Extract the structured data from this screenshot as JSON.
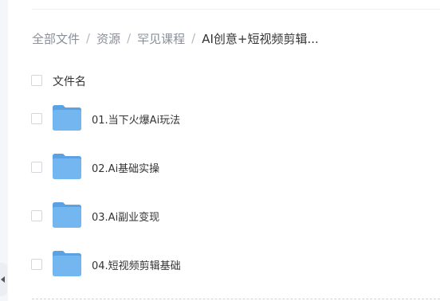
{
  "breadcrumb": {
    "items": [
      {
        "label": "全部文件"
      },
      {
        "label": "资源"
      },
      {
        "label": "罕见课程"
      },
      {
        "label": "AI创意+短视频剪辑..."
      }
    ],
    "separator": "/"
  },
  "file_list": {
    "header": {
      "name_label": "文件名"
    },
    "rows": [
      {
        "name": "01.当下火爆Ai玩法",
        "icon": "folder-icon"
      },
      {
        "name": "02.Ai基础实操",
        "icon": "folder-icon"
      },
      {
        "name": "03.Ai副业变现",
        "icon": "folder-icon"
      },
      {
        "name": "04.短视频剪辑基础",
        "icon": "folder-icon"
      }
    ]
  },
  "colors": {
    "folder": "#6fb3ee",
    "folder_back": "#5aa2e3",
    "text_primary": "#333333",
    "text_secondary": "#8a8f99"
  }
}
